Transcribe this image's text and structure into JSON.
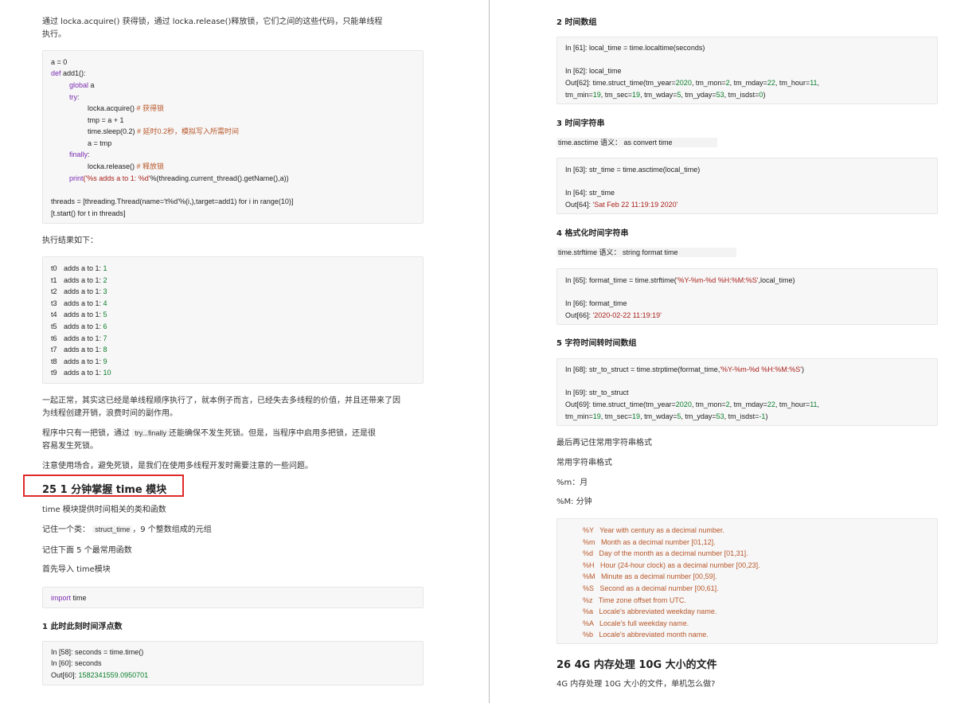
{
  "left": {
    "intro1": "通过 locka.acquire() 获得锁，通过 locka.release()释放锁，它们之间的这些代码，只能单线程",
    "intro2": "执行。",
    "code1": {
      "l1": "a = 0",
      "l2_kw": "def",
      "l2": " add1():",
      "l3_kw": "global",
      "l3": " a",
      "l4_kw": "try",
      "l5": "locka.acquire() ",
      "l5_c": "# 获得锁",
      "l6": "tmp = a + 1",
      "l7": "time.sleep(0.2) ",
      "l7_c": "# 延时0.2秒，模拟写入所需时间",
      "l8": "a = tmp",
      "l9_kw": "finally",
      "l10": "locka.release() ",
      "l10_c": "# 释放锁",
      "l11_kw": "print",
      "l11_s": "('%s   adds a to 1: %d'",
      "l11": "%(threading.current_thread().getName(),a))",
      "l12": "threads = [threading.Thread(name='t%d'%(i,),target=add1) for i in range(10)]",
      "l13": "[t.start() for t in threads]"
    },
    "result_label": "执行结果如下：",
    "results": [
      {
        "t": "t0",
        "v": "1"
      },
      {
        "t": "t1",
        "v": "2"
      },
      {
        "t": "t2",
        "v": "3"
      },
      {
        "t": "t3",
        "v": "4"
      },
      {
        "t": "t4",
        "v": "5"
      },
      {
        "t": "t5",
        "v": "6"
      },
      {
        "t": "t6",
        "v": "7"
      },
      {
        "t": "t7",
        "v": "8"
      },
      {
        "t": "t8",
        "v": "9"
      },
      {
        "t": "t9",
        "v": "10"
      }
    ],
    "results_mid": "adds a to 1: ",
    "para1a": "一起正常，其实这已经是单线程顺序执行了，就本例子而言，已经失去多线程的价值，并且还带来了因",
    "para1b": "为线程创建开销，浪费时间的副作用。",
    "para2a_pre": "程序中只有一把锁，通过 ",
    "para2a_code": "try...finally",
    "para2a_post": "还能确保不发生死锁。但是，当程序中启用多把锁，还是很",
    "para2b": "容易发生死锁。",
    "para3": "注意使用场合，避免死锁，是我们在使用多线程开发时需要注意的一些问题。",
    "heading25": "25 1 分钟掌握 time 模块",
    "t1": "time 模块提供时间相关的类和函数",
    "t2_pre": "记住一个类： ",
    "t2_code": "struct_time",
    "t2_post": "，9 个整数组成的元组",
    "t3": "记住下面 5 个最常用函数",
    "t4": "首先导入 time模块",
    "import_kw": "import",
    "import_rest": " time",
    "sub1": "1 此时此刻时间浮点数",
    "code_sec": {
      "l1": "In [58]: seconds = time.time()",
      "l2": "In [60]: seconds",
      "l3_pre": "Out[60]: ",
      "l3_val": "1582341559.0950701"
    }
  },
  "right": {
    "sub2": "2 时间数组",
    "c2": {
      "l1": "In [61]: local_time = time.localtime(seconds)",
      "l2": "In [62]: local_time",
      "l3a": "Out[62]: time.struct_time(tm_year=",
      "l3b": "2020",
      "l3c": ", tm_mon=",
      "l3d": "2",
      "l3e": ", tm_mday=",
      "l3f": "22",
      "l3g": ", tm_hour=",
      "l3h": "11",
      "l3i": ",",
      "l4a": "tm_min=",
      "l4b": "19",
      "l4c": ", tm_sec=",
      "l4d": "19",
      "l4e": ", tm_wday=",
      "l4f": "5",
      "l4g": ", tm_yday=",
      "l4h": "53",
      "l4i": ", tm_isdst=",
      "l4j": "0",
      "l4k": ")"
    },
    "sub3": "3 时间字符串",
    "tag3_code": "time.asctime",
    "tag3_mid": " 语义：  ",
    "tag3_val": "as convert time",
    "c3": {
      "l1": "In [63]: str_time = time.asctime(local_time)",
      "l2": "In [64]: str_time",
      "l3_pre": "Out[64]: ",
      "l3_val": "'Sat Feb 22 11:19:19 2020'"
    },
    "sub4": "4 格式化时间字符串",
    "tag4_code": "time.strftime",
    "tag4_mid": " 语义：  ",
    "tag4_val": "string format time",
    "c4": {
      "l1a": "In [65]: format_time = time.strftime(",
      "l1b": "'%Y-%m-%d %H:%M:%S'",
      "l1c": ",local_time)",
      "l2": "In [66]: format_time",
      "l3_pre": "Out[66]: ",
      "l3_val": "'2020-02-22 11:19:19'"
    },
    "sub5": "5 字符时间转时间数组",
    "c5": {
      "l1a": "In [68]: str_to_struct = time.strptime(format_time,",
      "l1b": "'%Y-%m-%d %H:%M:%S'",
      "l1c": ")",
      "l2": "In [69]: str_to_struct",
      "l3a": "Out[69]: time.struct_time(tm_year=",
      "l3b": "2020",
      "l3c": ", tm_mon=",
      "l3d": "2",
      "l3e": ", tm_mday=",
      "l3f": "22",
      "l3g": ", tm_hour=",
      "l3h": "11",
      "l3i": ",",
      "l4a": "tm_min=",
      "l4b": "19",
      "l4c": ", tm_sec=",
      "l4d": "19",
      "l4e": ", tm_wday=",
      "l4f": "5",
      "l4g": ", tm_yday=",
      "l4h": "53",
      "l4i": ", tm_isdst=",
      "l4j": "-1",
      "l4k": ")"
    },
    "note1": "最后再记住常用字符串格式",
    "note2": "常用字符串格式",
    "note3": "%m：月",
    "note4": "%M: 分钟",
    "formats": [
      "%Y   Year with century as a decimal number.",
      "%m   Month as a decimal number [01,12].",
      "%d   Day of the month as a decimal number [01,31].",
      "%H   Hour (24-hour clock) as a decimal number [00,23].",
      "%M   Minute as a decimal number [00,59].",
      "%S   Second as a decimal number [00,61].",
      "%z   Time zone offset from UTC.",
      "%a   Locale's abbreviated weekday name.",
      "%A   Locale's full weekday name.",
      "%b   Locale's abbreviated month name."
    ],
    "heading26": "26 4G 内存处理 10G 大小的文件",
    "q26": "4G 内存处理 10G 大小的文件，单机怎么做?"
  }
}
